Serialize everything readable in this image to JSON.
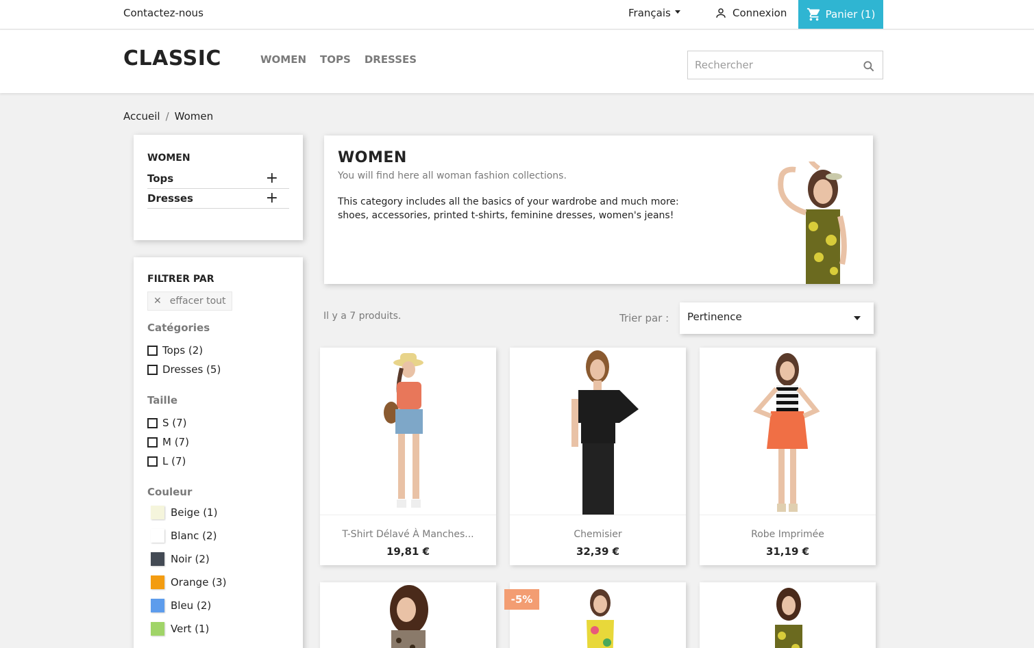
{
  "topbar": {
    "contact": "Contactez-nous",
    "language": "Français",
    "login": "Connexion",
    "cart": "Panier (1)"
  },
  "header": {
    "logo": "CLASSIC",
    "menu": [
      "WOMEN",
      "TOPS",
      "DRESSES"
    ],
    "search_placeholder": "Rechercher"
  },
  "breadcrumb": [
    "Accueil",
    "Women"
  ],
  "categories": {
    "title": "WOMEN",
    "items": [
      "Tops",
      "Dresses"
    ]
  },
  "filters": {
    "title": "FILTRER PAR",
    "clear_all": "effacer tout",
    "categories_title": "Catégories",
    "categories": [
      "Tops (2)",
      "Dresses (5)"
    ],
    "size_title": "Taille",
    "sizes": [
      "S (7)",
      "M (7)",
      "L (7)"
    ],
    "color_title": "Couleur",
    "colors": [
      {
        "label": "Beige (1)",
        "hex": "#f5f5dc"
      },
      {
        "label": "Blanc (2)",
        "hex": "#ffffff"
      },
      {
        "label": "Noir (2)",
        "hex": "#434a54"
      },
      {
        "label": "Orange (3)",
        "hex": "#f39c11"
      },
      {
        "label": "Bleu (2)",
        "hex": "#5d9cec"
      },
      {
        "label": "Vert (1)",
        "hex": "#a0d468"
      }
    ]
  },
  "category_header": {
    "title": "WOMEN",
    "subtitle": "You will find here all woman fashion collections.",
    "description_line1": "This category includes all the basics of your wardrobe and much more:",
    "description_line2": "shoes, accessories, printed t-shirts, feminine dresses, women's jeans!"
  },
  "listing": {
    "count": "Il y a 7 produits.",
    "sort_label": "Trier par :",
    "sort_value": "Pertinence"
  },
  "products": [
    {
      "name": "T-Shirt Délavé À Manches...",
      "price": "19,81 €"
    },
    {
      "name": "Chemisier",
      "price": "32,39 €"
    },
    {
      "name": "Robe Imprimée",
      "price": "31,19 €"
    }
  ],
  "discount_badge": "-5%",
  "colors": {
    "accent": "#2fb5d2",
    "badge": "#f39d72"
  }
}
